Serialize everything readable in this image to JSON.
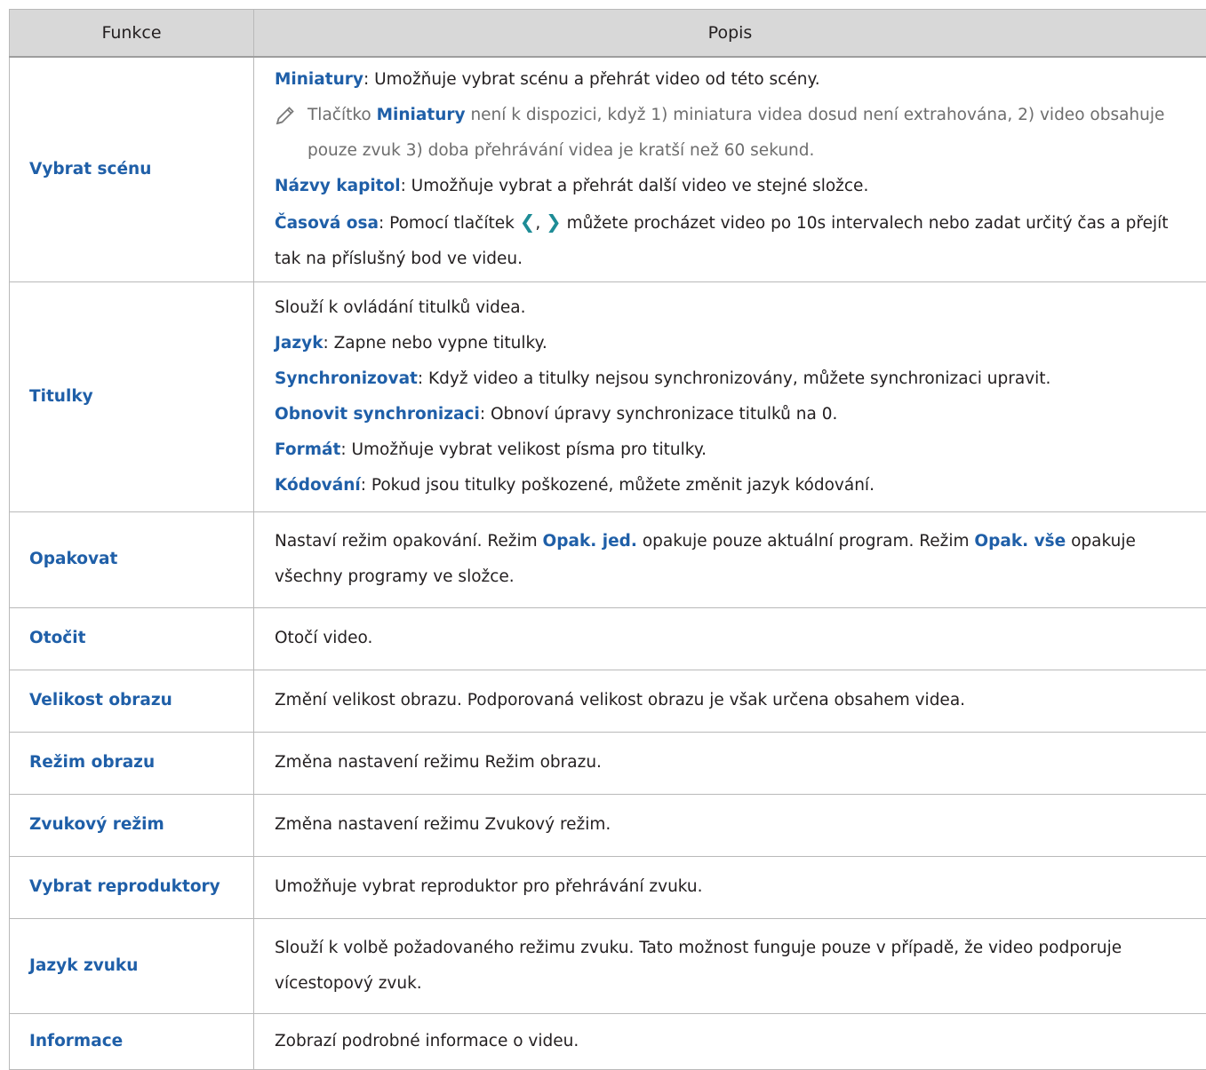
{
  "table": {
    "headers": [
      "Funkce",
      "Popis"
    ],
    "rows": [
      {
        "name": "Vybrat scénu",
        "thumbs": {
          "kw": "Miniatury",
          "text": ": Umožňuje vybrat scénu a přehrát video od této scény."
        },
        "note": {
          "before": "Tlačítko ",
          "kw": "Miniatury",
          "after": " není k dispozici, když 1) miniatura videa dosud není extrahována, 2) video obsahuje pouze zvuk 3) doba přehrávání videa je kratší než 60 sekund.",
          "icon": "pencil-note-icon"
        },
        "chapters": {
          "kw": "Názvy kapitol",
          "text": ": Umožňuje vybrat a přehrát další video ve stejné složce."
        },
        "timeline": {
          "kw": "Časová osa",
          "before": ": Pomocí tlačítek ",
          "left_arrow": "❮",
          "comma": ", ",
          "right_arrow": "❯",
          "after": " můžete procházet video po 10s intervalech nebo zadat určitý čas a přejít tak na příslušný bod ve videu.",
          "arrow_icons": [
            "chevron-left-icon",
            "chevron-right-icon"
          ]
        }
      },
      {
        "name": "Titulky",
        "intro": "Slouží k ovládání titulků videa.",
        "items": [
          {
            "kw": "Jazyk",
            "text": ": Zapne nebo vypne titulky."
          },
          {
            "kw": "Synchronizovat",
            "text": ": Když video a titulky nejsou synchronizovány, můžete synchronizaci upravit."
          },
          {
            "kw": "Obnovit synchronizaci",
            "text": ": Obnoví úpravy synchronizace titulků na 0."
          },
          {
            "kw": "Formát",
            "text": ": Umožňuje vybrat velikost písma pro titulky."
          },
          {
            "kw": "Kódování",
            "text": ": Pokud jsou titulky poškozené, můžete změnit jazyk kódování."
          }
        ]
      },
      {
        "name": "Opakovat",
        "p1": "Nastaví režim opakování. Režim ",
        "kw1": "Opak. jed.",
        "p2": " opakuje pouze aktuální program. Režim ",
        "kw2": "Opak. vše",
        "p3": " opakuje všechny programy ve složce."
      },
      {
        "name": "Otočit",
        "desc": "Otočí video."
      },
      {
        "name": "Velikost obrazu",
        "desc": "Změní velikost obrazu. Podporovaná velikost obrazu je však určena obsahem videa."
      },
      {
        "name": "Režim obrazu",
        "desc": "Změna nastavení režimu Režim obrazu."
      },
      {
        "name": "Zvukový režim",
        "desc": "Změna nastavení režimu Zvukový režim."
      },
      {
        "name": "Vybrat reproduktory",
        "desc": "Umožňuje vybrat reproduktor pro přehrávání zvuku."
      },
      {
        "name": "Jazyk zvuku",
        "desc": "Slouží k volbě požadovaného režimu zvuku. Tato možnost funguje pouze v případě, že video podporuje vícestopový zvuk."
      },
      {
        "name": "Informace",
        "desc": "Zobrazí podrobné informace o videu."
      }
    ]
  },
  "colors": {
    "header_bg": "#d8d8d8",
    "keyword": "#1f5fa8",
    "arrow": "#1e8c96",
    "note_text": "#6d6d6d",
    "border": "#b9b9b9"
  }
}
